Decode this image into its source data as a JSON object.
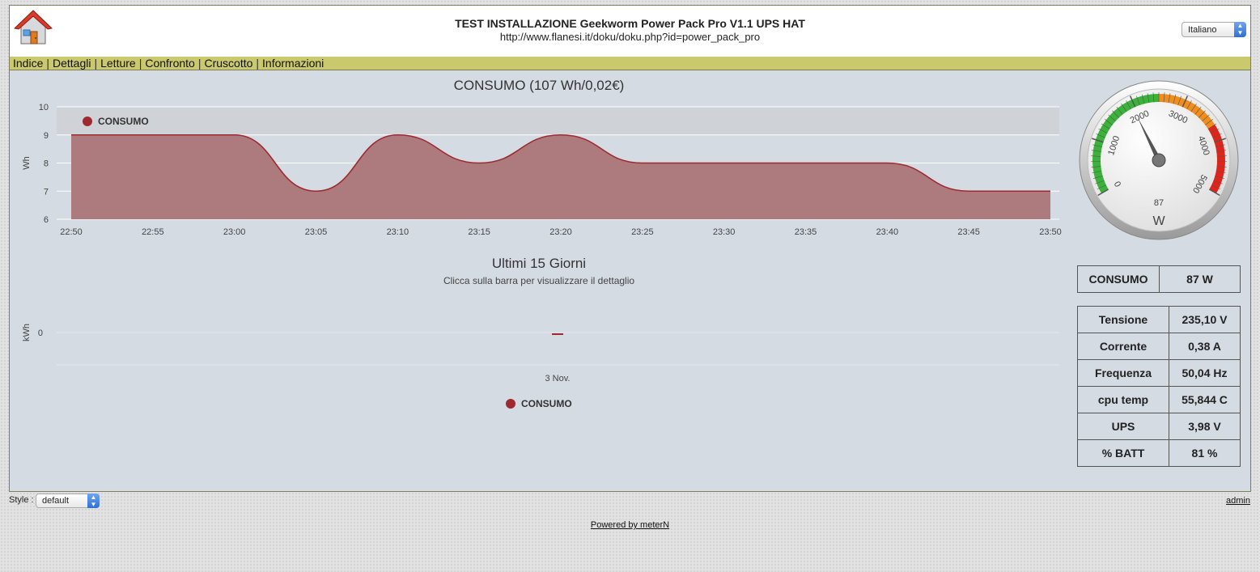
{
  "header": {
    "title": "TEST INSTALLAZIONE Geekworm Power Pack Pro V1.1 UPS HAT",
    "url": "http://www.flanesi.it/doku/doku.php?id=power_pack_pro",
    "language_selected": "Italiano"
  },
  "menu": [
    "Indice",
    "Dettagli",
    "Letture",
    "Confronto",
    "Cruscotto",
    "Informazioni"
  ],
  "chart_data": [
    {
      "type": "area",
      "title": "CONSUMO (107 Wh/0,02€)",
      "ylabel": "Wh",
      "ylim": [
        6,
        10
      ],
      "yticks": [
        "6",
        "7",
        "8",
        "9",
        "10"
      ],
      "xticks": [
        "22:50",
        "22:55",
        "23:00",
        "23:05",
        "23:10",
        "23:15",
        "23:20",
        "23:25",
        "23:30",
        "23:35",
        "23:40",
        "23:45",
        "23:50"
      ],
      "x": [
        "22:50",
        "22:55",
        "23:00",
        "23:05",
        "23:10",
        "23:15",
        "23:20",
        "23:25",
        "23:30",
        "23:35",
        "23:40",
        "23:45",
        "23:50"
      ],
      "series": [
        {
          "name": "CONSUMO",
          "values": [
            9,
            9,
            9,
            7,
            9,
            8,
            9,
            8,
            8,
            8,
            8,
            7,
            7
          ]
        }
      ],
      "legend": "top-left",
      "grid": true,
      "colors": {
        "series": "#9e2a2f",
        "fill": "#ad7b7e",
        "plot_band": "#cfd2d7"
      }
    },
    {
      "type": "bar",
      "title": "Ultimi 15 Giorni",
      "subtitle": "Clicca sulla barra per visualizzare il dettaglio",
      "ylabel": "kWh",
      "yticks": [
        "0"
      ],
      "categories": [
        "3 Nov."
      ],
      "series": [
        {
          "name": "CONSUMO",
          "values": [
            0
          ]
        }
      ],
      "legend": "bottom-center",
      "colors": {
        "series": "#9e2a2f"
      }
    }
  ],
  "gauge": {
    "value": 87,
    "value_label": "87",
    "unit": "W",
    "min": 0,
    "max": 5000,
    "tick_labels": [
      "0",
      "1000",
      "2000",
      "3000",
      "4000",
      "5000"
    ],
    "bands": [
      {
        "from": 0,
        "to": 2500,
        "color": "#3bb33b"
      },
      {
        "from": 2500,
        "to": 3700,
        "color": "#f08d1d"
      },
      {
        "from": 3700,
        "to": 5000,
        "color": "#e2231a"
      }
    ]
  },
  "consumo_table": {
    "label": "CONSUMO",
    "value": "87 W"
  },
  "readings": [
    {
      "label": "Tensione",
      "value": "235,10 V"
    },
    {
      "label": "Corrente",
      "value": "0,38 A"
    },
    {
      "label": "Frequenza",
      "value": "50,04 Hz"
    },
    {
      "label": "cpu temp",
      "value": "55,844 C"
    },
    {
      "label": "UPS",
      "value": "3,98 V"
    },
    {
      "label": "% BATT",
      "value": "81 %"
    }
  ],
  "footer": {
    "style_label": "Style :",
    "style_selected": "default",
    "admin_link": "admin",
    "powered_by": "Powered by meterN"
  }
}
